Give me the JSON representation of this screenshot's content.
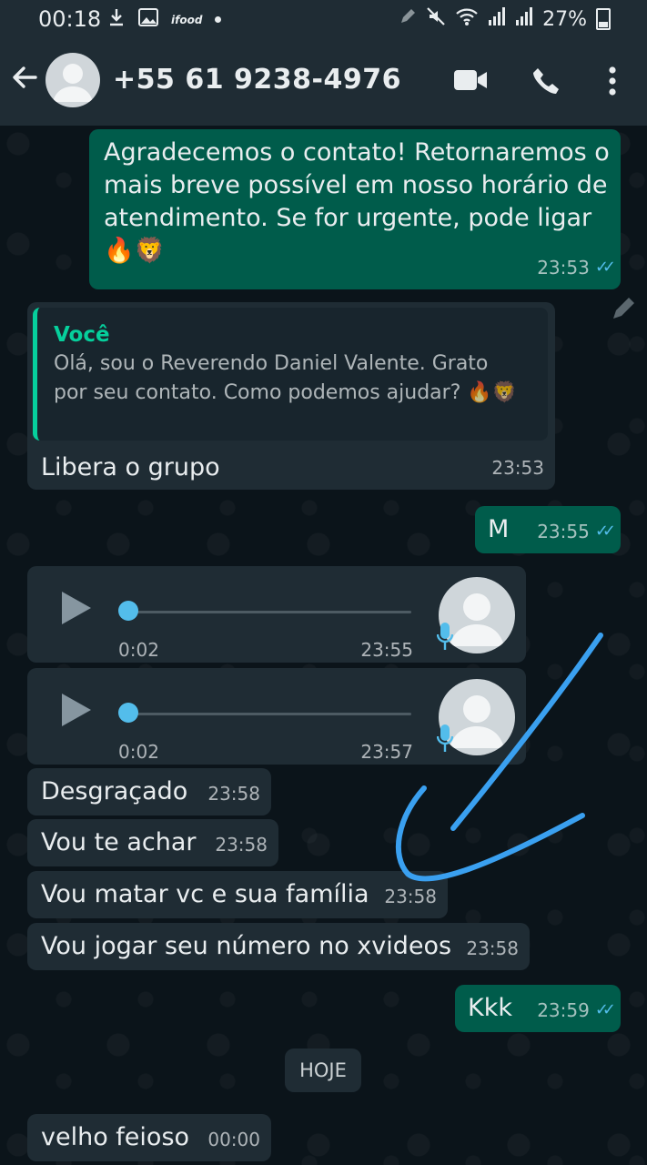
{
  "status_bar": {
    "time": "00:18",
    "left_icons": [
      "download-icon",
      "image-icon",
      "ifood-icon",
      "dot-icon"
    ],
    "ifood_label": "ifood",
    "battery": "27%",
    "right_icons": [
      "edit-icon",
      "mute-icon",
      "wifi-icon",
      "signal-icon",
      "signal-icon",
      "battery-icon"
    ]
  },
  "app_bar": {
    "title": "+55 61 9238-4976",
    "actions": [
      "video-call-icon",
      "phone-call-icon",
      "more-options-icon"
    ]
  },
  "messages": [
    {
      "type": "text",
      "direction": "out",
      "text": "Agradecemos o contato! Retornaremos o mais breve possível em nosso horário de atendimento. Se for urgente, pode ligar 🔥🦁",
      "time": "23:53",
      "status": "read"
    },
    {
      "type": "reply",
      "direction": "in",
      "quote_author": "Você",
      "quote_text": "Olá, sou o Reverendo Daniel Valente. Grato por seu contato. Como podemos ajudar? 🔥🦁",
      "text": "Libera o grupo",
      "time": "23:53"
    },
    {
      "type": "text",
      "direction": "out",
      "text": "M",
      "time": "23:55",
      "status": "read"
    },
    {
      "type": "voice",
      "direction": "in",
      "duration": "0:02",
      "time": "23:55"
    },
    {
      "type": "voice",
      "direction": "in",
      "duration": "0:02",
      "time": "23:57"
    },
    {
      "type": "text",
      "direction": "in",
      "text": "Desgraçado",
      "time": "23:58"
    },
    {
      "type": "text",
      "direction": "in",
      "text": "Vou te achar",
      "time": "23:58"
    },
    {
      "type": "text",
      "direction": "in",
      "text": "Vou matar vc e sua família",
      "time": "23:58"
    },
    {
      "type": "text",
      "direction": "in",
      "text": "Vou jogar seu número no xvideos",
      "time": "23:58"
    },
    {
      "type": "text",
      "direction": "out",
      "text": "Kkk",
      "time": "23:59",
      "status": "read"
    },
    {
      "type": "text",
      "direction": "in",
      "text": "velho feioso",
      "time": "00:00"
    }
  ],
  "day_divider": "HOJE",
  "colors": {
    "background": "#0b141a",
    "header": "#1f2c34",
    "incoming_bubble": "#1f2c34",
    "outgoing_bubble": "#005c4b",
    "read_ticks": "#53bdeb",
    "quote_accent": "#06cf9c",
    "annotation_stroke": "#3aa0f0"
  }
}
